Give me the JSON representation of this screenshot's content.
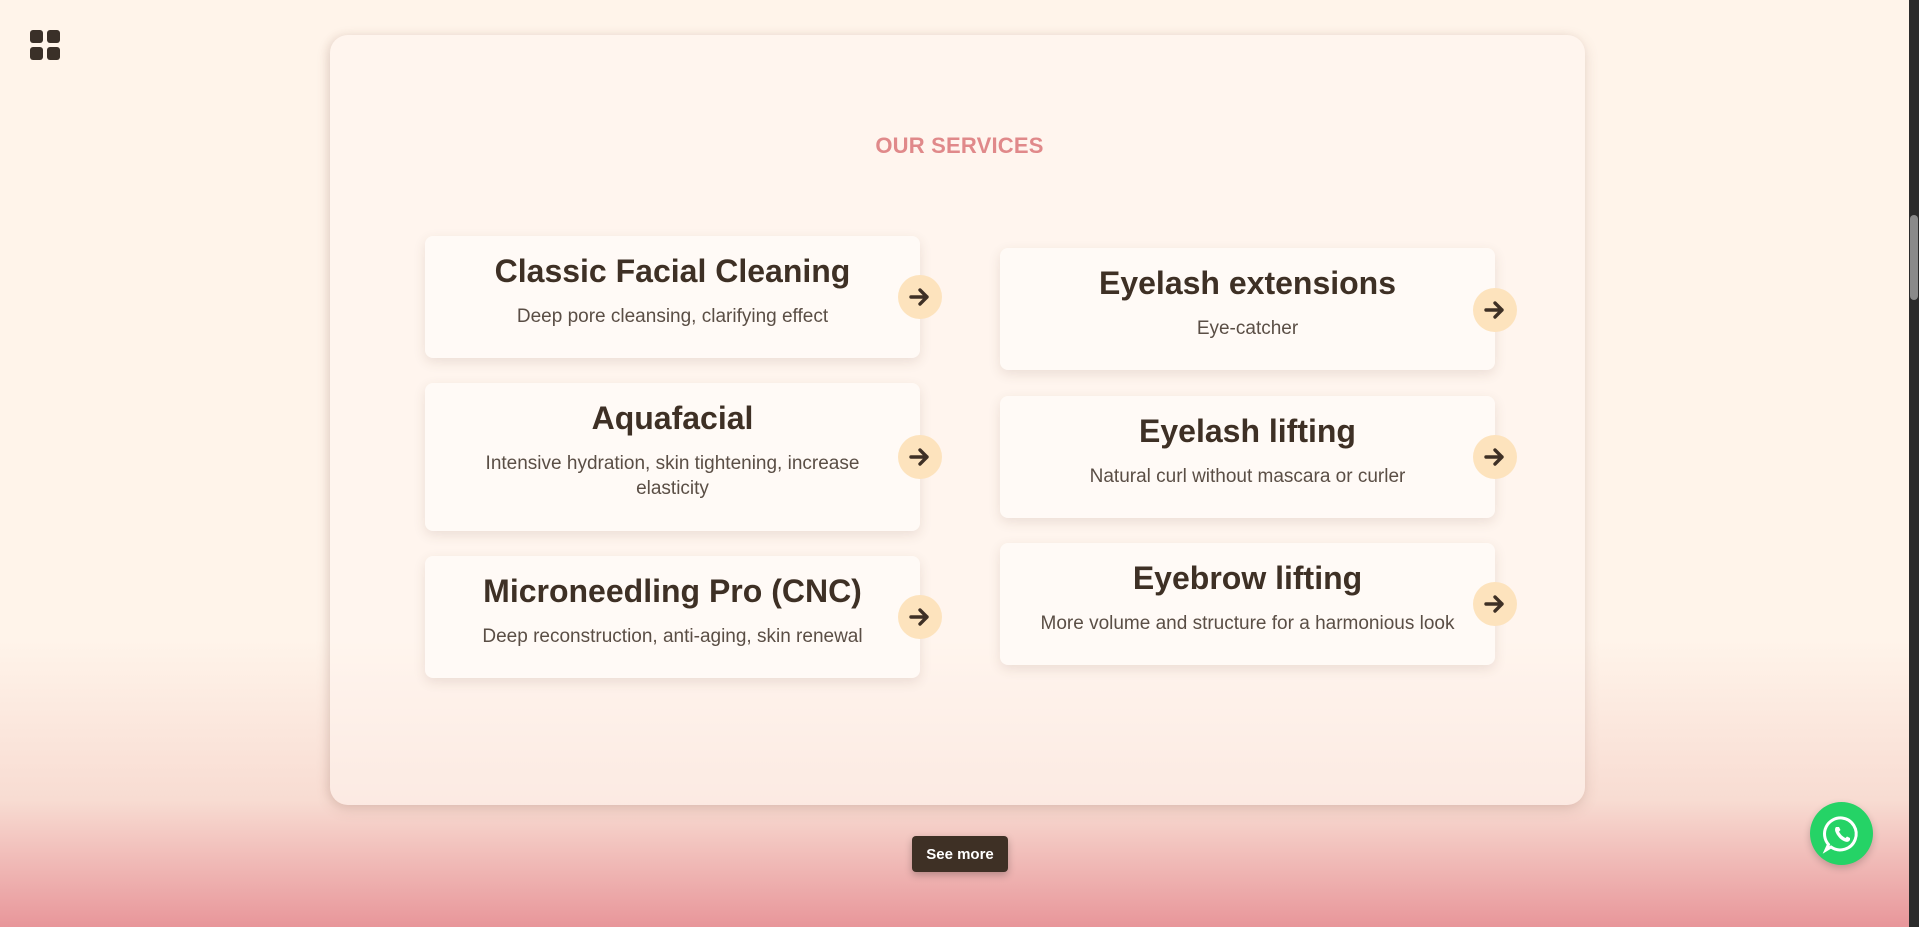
{
  "nav": {
    "menu_icon": "grid-icon"
  },
  "services": {
    "title": "OUR SERVICES",
    "items": [
      {
        "title": "Classic Facial Cleaning",
        "description": "Deep pore cleansing, clarifying effect"
      },
      {
        "title": "Eyelash extensions",
        "description": "Eye-catcher"
      },
      {
        "title": "Aquafacial",
        "description": "Intensive hydration, skin tightening, increase elasticity"
      },
      {
        "title": "Eyelash lifting",
        "description": "Natural curl without mascara or curler"
      },
      {
        "title": "Microneedling Pro (CNC)",
        "description": "Deep reconstruction, anti-aging, skin renewal"
      },
      {
        "title": "Eyebrow lifting",
        "description": "More volume and structure for a harmonious look"
      }
    ],
    "see_more_label": "See more"
  },
  "floating": {
    "whatsapp_icon": "whatsapp-icon"
  },
  "colors": {
    "accent": "#e0898a",
    "dark": "#3e3025",
    "arrow_bg": "#fde3bd",
    "whatsapp": "#25d366"
  }
}
